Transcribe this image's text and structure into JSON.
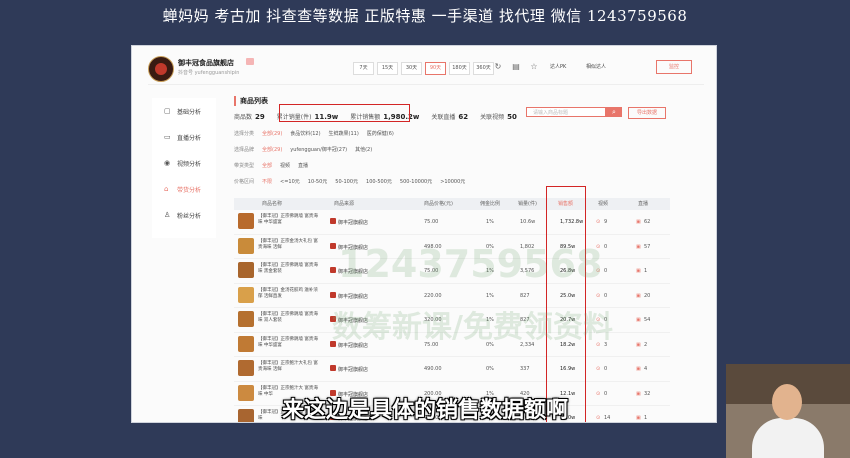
{
  "banner": {
    "text": "蝉妈妈 考古加 抖查查等数据 正版特惠 一手渠道 找代理 微信 1243759568"
  },
  "shop": {
    "name": "御丰冠食品旗舰店",
    "sub": "抖音号 yufengguanshipin"
  },
  "header": {
    "ranges": [
      "7天",
      "15天",
      "30天",
      "90天",
      "180天",
      "360天"
    ],
    "active_range": "90天",
    "compare_label": "达人PK",
    "related_label": "相似达人",
    "monitor_label": "监控"
  },
  "sidebar": {
    "items": [
      {
        "label": "基础分析",
        "icon": "▢"
      },
      {
        "label": "直播分析",
        "icon": "▭"
      },
      {
        "label": "视频分析",
        "icon": "◉"
      },
      {
        "label": "带货分析",
        "icon": "⌂"
      },
      {
        "label": "粉丝分析",
        "icon": "♙"
      }
    ],
    "active_index": 3
  },
  "main": {
    "title": "商品列表",
    "stats": [
      {
        "label": "商品数",
        "value": "29"
      },
      {
        "label": "累计销量(件)",
        "value": "11.9w"
      },
      {
        "label": "累计销售额",
        "value": "1,980.2w"
      },
      {
        "label": "关联直播",
        "value": "62"
      },
      {
        "label": "关联视频",
        "value": "50"
      }
    ],
    "search_placeholder": "请输入商品标题",
    "export_label": "导出数据",
    "filters": [
      {
        "label": "选择分类",
        "options": [
          "全部(29)",
          "食品饮料(12)",
          "生鲜蔬果(11)",
          "医药保健(6)"
        ]
      },
      {
        "label": "选择品牌",
        "options": [
          "全部(29)",
          "yufengguan/御丰冠(27)",
          "其他(2)"
        ]
      },
      {
        "label": "带货类型",
        "options": [
          "全部",
          "视频",
          "直播"
        ]
      },
      {
        "label": "价格区间",
        "options": [
          "不限",
          "<=10元",
          "10-50元",
          "50-100元",
          "100-500元",
          "500-10000元",
          ">10000元"
        ]
      }
    ],
    "columns": [
      "商品名称",
      "商品来源",
      "商品价格(元)",
      "佣金比例",
      "销量(件)",
      "销售额",
      "视频",
      "直播"
    ],
    "rows": [
      {
        "name": "【御丰冠】正宗佛跳墙 富贵海味 中华盛宴",
        "shop": "御丰冠旗舰店",
        "price": "75.00",
        "commission": "1%",
        "volume": "10.6w",
        "sales": "1,732.8w",
        "video": "9",
        "live": "62"
      },
      {
        "name": "【御丰冠】正宗金汤大礼包 富贵海味 活鲜",
        "shop": "御丰冠旗舰店",
        "price": "498.00",
        "commission": "0%",
        "volume": "1,802",
        "sales": "89.5w",
        "video": "0",
        "live": "57"
      },
      {
        "name": "【御丰冠】正宗佛跳墙 富贵海味 黑金套装",
        "shop": "御丰冠旗舰店",
        "price": "75.00",
        "commission": "1%",
        "volume": "3,576",
        "sales": "26.8w",
        "video": "0",
        "live": "1"
      },
      {
        "name": "【御丰冠】金汤花胶鸡 滋补浓郁 活鲜直发",
        "shop": "御丰冠旗舰店",
        "price": "220.00",
        "commission": "1%",
        "volume": "827",
        "sales": "25.0w",
        "video": "0",
        "live": "20"
      },
      {
        "name": "【御丰冠】正宗佛跳墙 富贵海味 双人套装",
        "shop": "御丰冠旗舰店",
        "price": "320.00",
        "commission": "1%",
        "volume": "827",
        "sales": "20.7w",
        "video": "0",
        "live": "54"
      },
      {
        "name": "【御丰冠】正宗佛跳墙 富贵海味 中华盛宴",
        "shop": "御丰冠旗舰店",
        "price": "75.00",
        "commission": "0%",
        "volume": "2,334",
        "sales": "18.2w",
        "video": "3",
        "live": "2"
      },
      {
        "name": "【御丰冠】正宗鲍汁大礼包 富贵海味 活鲜",
        "shop": "御丰冠旗舰店",
        "price": "490.00",
        "commission": "0%",
        "volume": "337",
        "sales": "16.9w",
        "video": "0",
        "live": "4"
      },
      {
        "name": "【御丰冠】正宗鲍汁大 富贵海味 中华",
        "shop": "御丰冠旗舰店",
        "price": "200.00",
        "commission": "1%",
        "volume": "420",
        "sales": "12.1w",
        "video": "0",
        "live": "32"
      },
      {
        "name": "【御丰冠】正宗佛跳墙 富贵海味",
        "shop": "御丰冠旗舰店",
        "price": "75.00",
        "commission": "1%",
        "volume": "1,612",
        "sales": "12.0w",
        "video": "14",
        "live": "1"
      }
    ]
  },
  "watermarks": [
    "1243759568",
    "数筹新课/免费领资料"
  ],
  "subtitle": "来这边是具体的销售数据额啊",
  "colors": {
    "accent": "#e8756a",
    "highlight": "#d32525"
  }
}
